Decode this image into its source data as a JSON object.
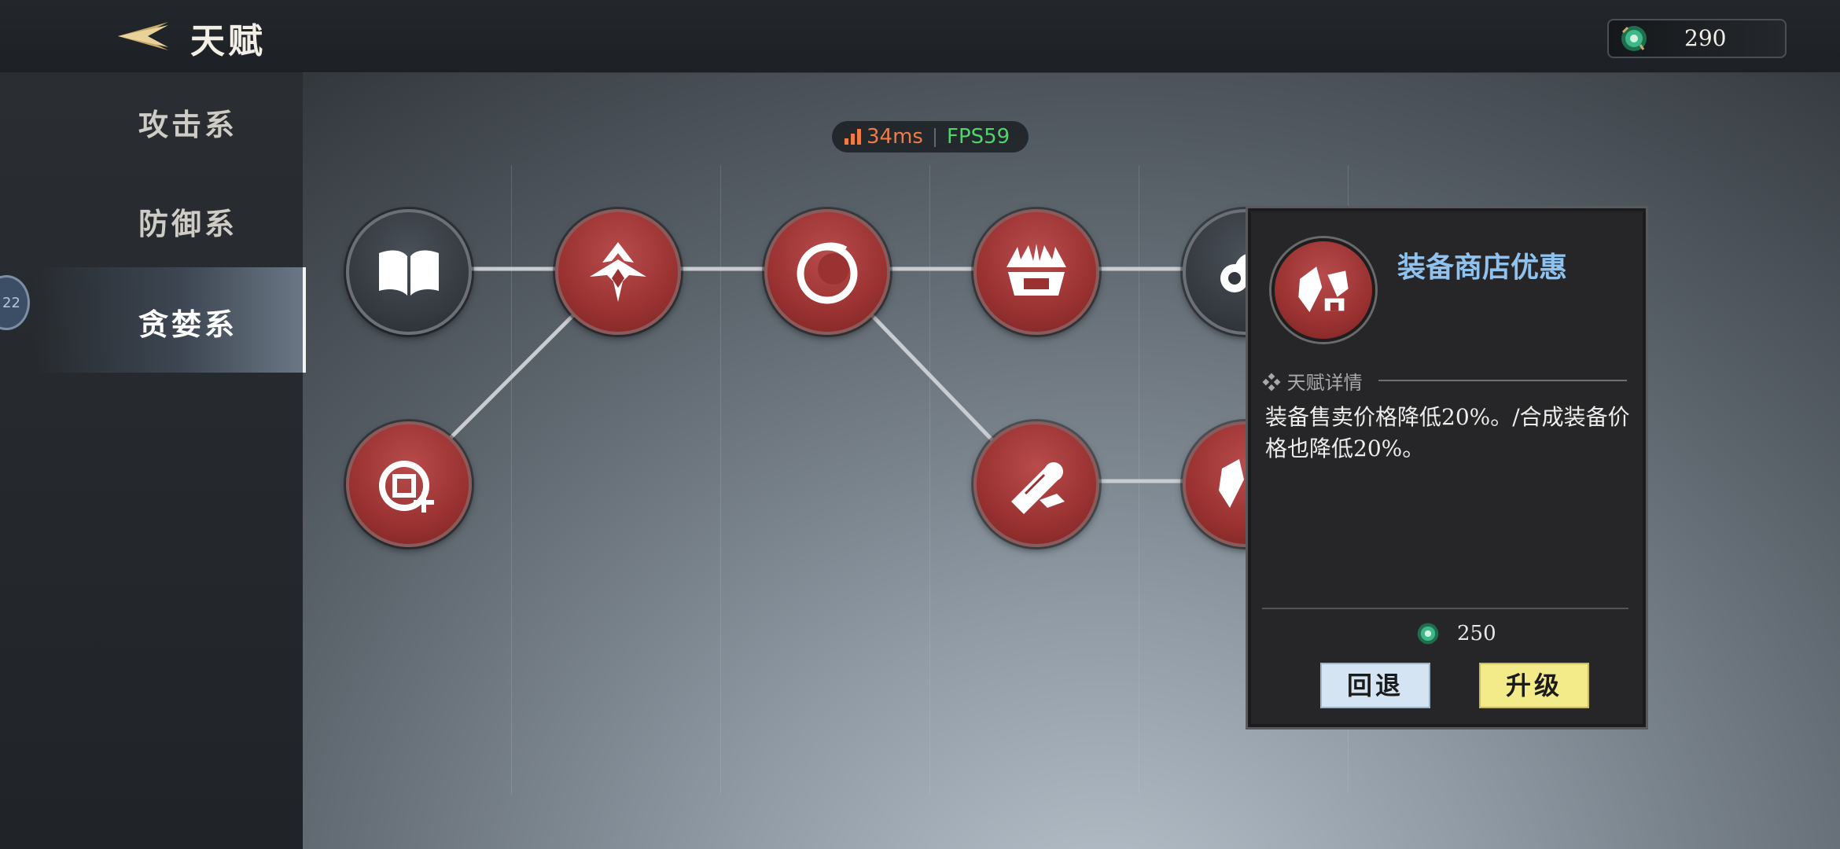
{
  "header": {
    "title": "天赋",
    "currency": "290"
  },
  "perf": {
    "ping": "34ms",
    "fps": "FPS59"
  },
  "sidebar": {
    "items": [
      {
        "label": "攻击系"
      },
      {
        "label": "防御系"
      },
      {
        "label": "贪婪系"
      }
    ],
    "active_index": 2,
    "level_badge": "22"
  },
  "tree": {
    "nodes": [
      {
        "id": "book",
        "icon": "book-icon",
        "state": "locked-gray"
      },
      {
        "id": "shield-wing",
        "icon": "winged-blade-icon",
        "state": "active-red"
      },
      {
        "id": "ring",
        "icon": "crescent-ring-icon",
        "state": "active-red"
      },
      {
        "id": "crown",
        "icon": "claw-crown-icon",
        "state": "active-red"
      },
      {
        "id": "cloud",
        "icon": "cloud-icon",
        "state": "locked-gray"
      },
      {
        "id": "coin-plus",
        "icon": "coin-plus-icon",
        "state": "active-red"
      },
      {
        "id": "scroll-shop",
        "icon": "scroll-shop-icon",
        "state": "active-red"
      },
      {
        "id": "shop-discount",
        "icon": "shop-discount-icon",
        "state": "active-red"
      }
    ]
  },
  "detail": {
    "title": "装备商店优惠",
    "section_label": "天赋详情",
    "description": "装备售卖价格降低20%。/合成装备价格也降低20%。",
    "cost": "250",
    "back_label": "回退",
    "upgrade_label": "升级"
  },
  "colors": {
    "accent_blue": "#8fc2ee",
    "node_red": "#9a3232",
    "upgrade_yellow": "#f3eb8a",
    "back_blue": "#d5e4f2"
  }
}
